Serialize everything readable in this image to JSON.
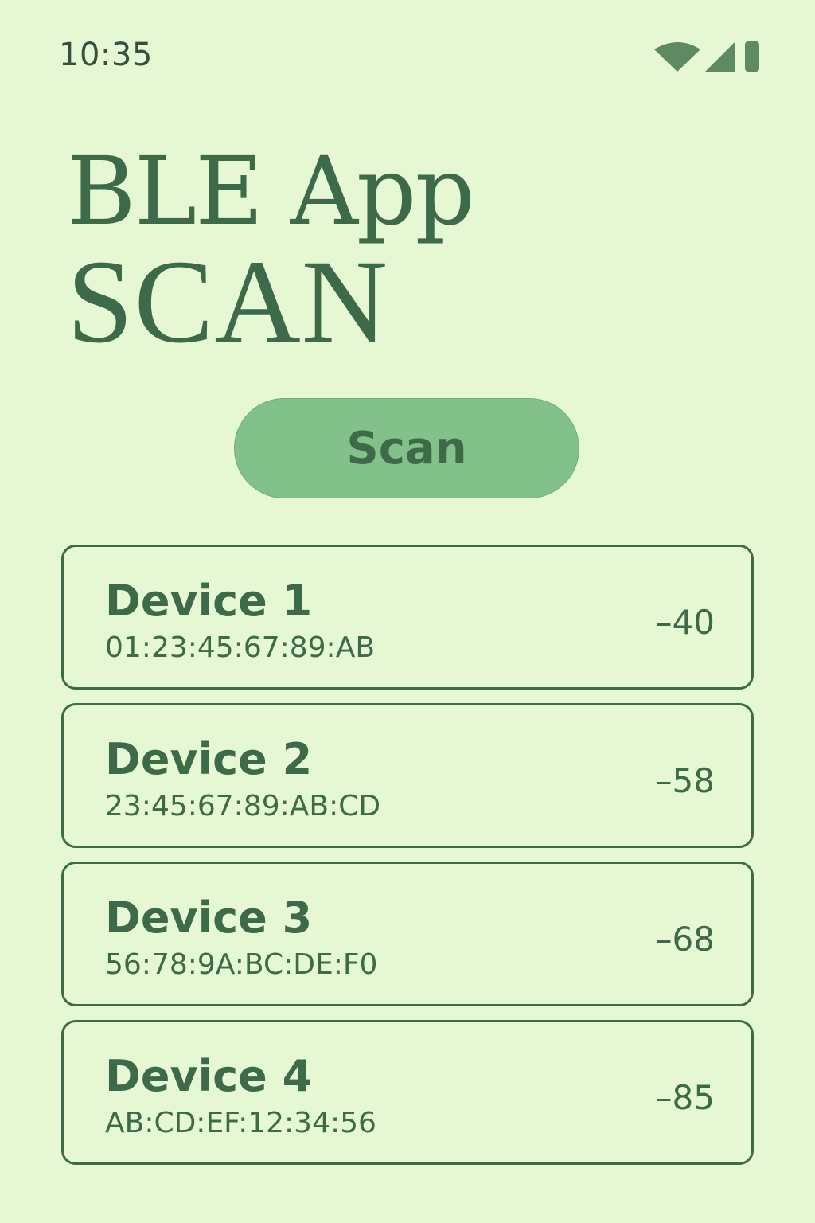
{
  "status_bar": {
    "time": "10:35",
    "icons": [
      "wifi-icon",
      "cellular-signal-icon",
      "battery-icon"
    ]
  },
  "header": {
    "title_line1": "BLE App",
    "title_line2": "SCAN"
  },
  "scan_button": {
    "label": "Scan"
  },
  "devices": [
    {
      "name": "Device 1",
      "mac": "01:23:45:67:89:AB",
      "rssi": "–40"
    },
    {
      "name": "Device 2",
      "mac": "23:45:67:89:AB:CD",
      "rssi": "–58"
    },
    {
      "name": "Device 3",
      "mac": "56:78:9A:BC:DE:F0",
      "rssi": "–68"
    },
    {
      "name": "Device 4",
      "mac": "AB:CD:EF:12:34:56",
      "rssi": "–85"
    }
  ],
  "colors": {
    "background": "#e6f7d3",
    "primary_text": "#3d6a48",
    "button_fill": "#82c189",
    "icon": "#5e8a63"
  }
}
